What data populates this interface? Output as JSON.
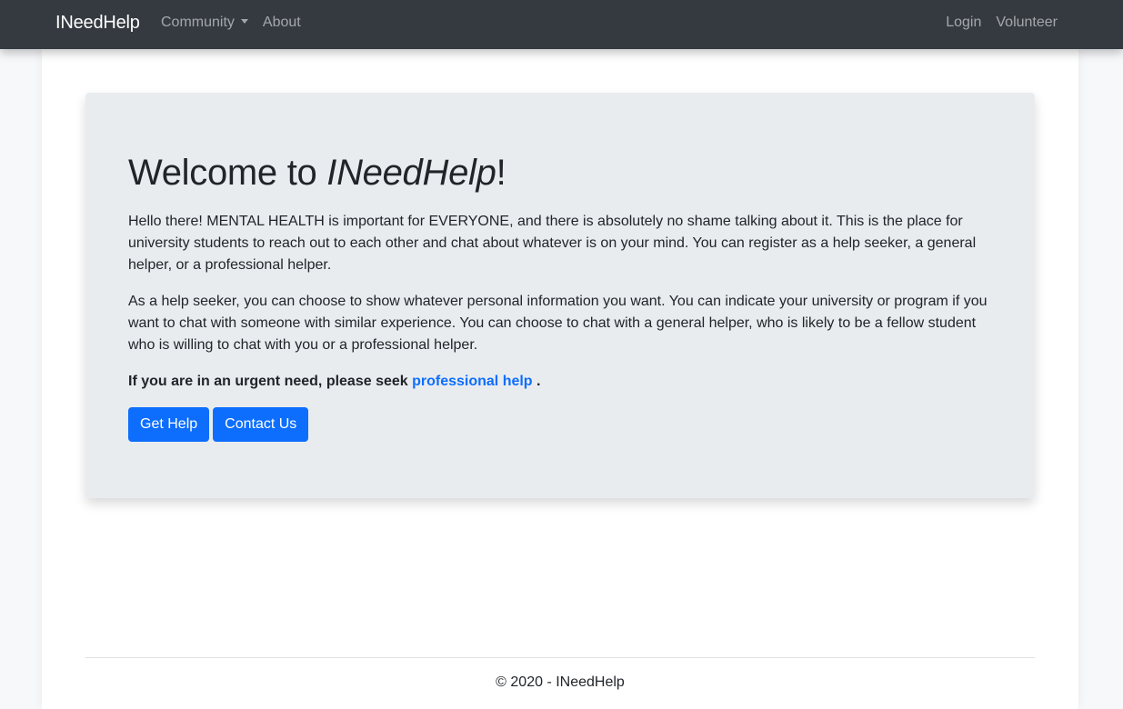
{
  "navbar": {
    "brand": "INeedHelp",
    "left_items": [
      {
        "label": "Community",
        "has_dropdown": true
      },
      {
        "label": "About",
        "has_dropdown": false
      }
    ],
    "right_items": [
      {
        "label": "Login"
      },
      {
        "label": "Volunteer"
      }
    ],
    "dropdown_icon": "caret-down-icon"
  },
  "jumbotron": {
    "title_prefix": "Welcome to ",
    "title_brand": "INeedHelp",
    "title_suffix": "!",
    "paragraph1": "Hello there! MENTAL HEALTH is important for EVERYONE, and there is absolutely no shame talking about it. This is the place for university students to reach out to each other and chat about whatever is on your mind. You can register as a help seeker, a general helper, or a professional helper.",
    "paragraph2": "As a help seeker, you can choose to show whatever personal information you want. You can indicate your university or program if you want to chat with someone with similar experience. You can choose to chat with a general helper, who is likely to be a fellow student who is willing to chat with you or a professional helper.",
    "urgent_prefix": "If you are in an urgent need, please seek ",
    "urgent_link": "professional help",
    "urgent_suffix": " .",
    "buttons": {
      "get_help": "Get Help",
      "contact_us": "Contact Us"
    }
  },
  "footer": {
    "text": "© 2020 - INeedHelp"
  },
  "colors": {
    "navbar_bg": "#343a40",
    "jumbotron_bg": "#e9ecef",
    "primary": "#0d6efd",
    "link": "#0d6efd"
  }
}
